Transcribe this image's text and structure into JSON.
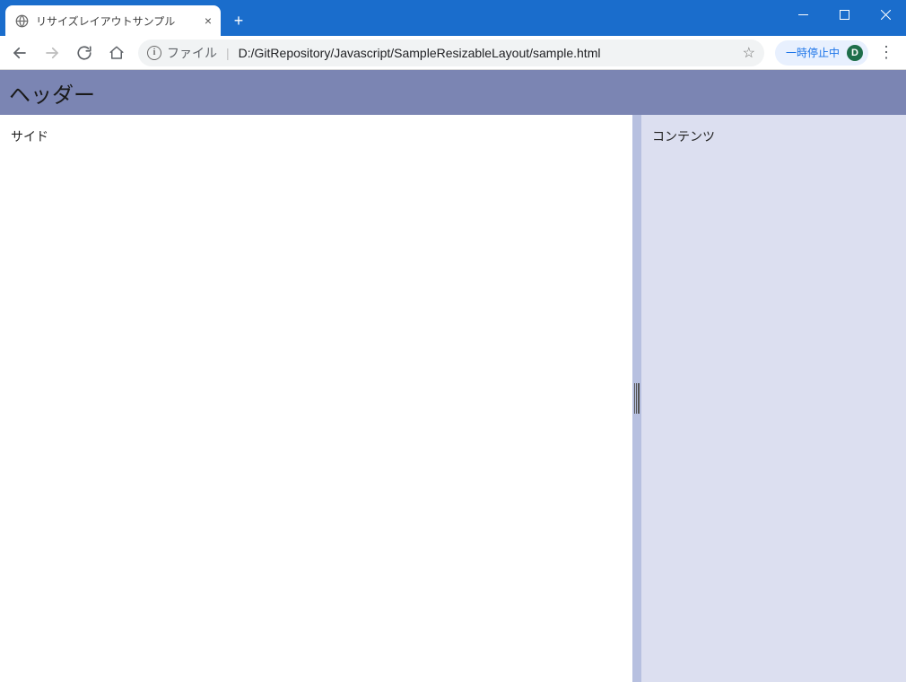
{
  "window": {
    "tab_title": "リサイズレイアウトサンプル"
  },
  "toolbar": {
    "scheme_label": "ファイル",
    "url": "D:/GitRepository/Javascript/SampleResizableLayout/sample.html",
    "paused_label": "一時停止中",
    "avatar_letter": "D"
  },
  "page": {
    "header_text": "ヘッダー",
    "side_text": "サイド",
    "content_text": "コンテンツ"
  }
}
